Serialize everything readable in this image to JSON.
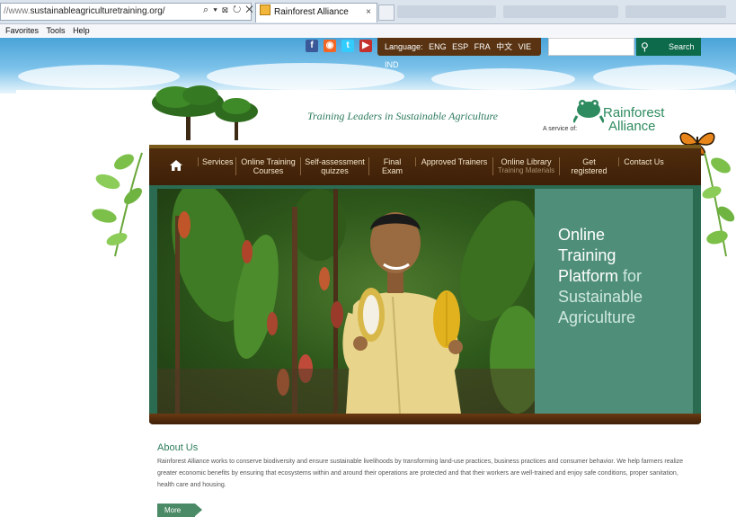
{
  "browser": {
    "url_prefix": "//www.",
    "url_main": "sustainableagriculturetraining.org/",
    "address_controls": "⌕ ▾ ⊠ ↻ ✕",
    "active_tab_title": "Rainforest Alliance",
    "active_tab_close": "×",
    "menu": [
      "Favorites",
      "Tools",
      "Help"
    ]
  },
  "header": {
    "social_icons": [
      "facebook-icon",
      "rss-icon",
      "twitter-icon",
      "youtube-icon"
    ],
    "social_glyphs": [
      "f",
      "◉",
      "t",
      "▶"
    ],
    "social_colors": [
      "#3b5998",
      "#f26522",
      "#33ccff",
      "#c4302b"
    ],
    "language_label": "Language:",
    "languages": [
      "ENG",
      "ESP",
      "FRA",
      "中文",
      "VIE",
      "IND"
    ],
    "search_button": "Search",
    "tagline": "Training Leaders in Sustainable Agriculture",
    "service_of": "A service of:",
    "brand_line1": "Rainforest",
    "brand_line2": "Alliance"
  },
  "nav": {
    "items": [
      {
        "label": "Services",
        "sub": ""
      },
      {
        "label": "Online Training Courses",
        "sub": ""
      },
      {
        "label": "Self-assessment quizzes",
        "sub": ""
      },
      {
        "label": "Final Exam",
        "sub": ""
      },
      {
        "label": "Approved Trainers",
        "sub": ""
      },
      {
        "label": "Online Library",
        "sub": "Training Materials"
      },
      {
        "label": "Get registered",
        "sub": ""
      },
      {
        "label": "Contact Us",
        "sub": ""
      }
    ]
  },
  "hero": {
    "line1": "Online",
    "line2": "Training",
    "line3a": "Platform",
    "line3b": " for",
    "line4": "Sustainable",
    "line5": "Agriculture"
  },
  "about": {
    "title": "About Us",
    "text": "Rainforest Alliance works to conserve biodiversity and ensure sustainable livelihoods by transforming land-use practices, business practices and consumer behavior. We help farmers realize greater economic benefits by ensuring that ecosystems within and around their operations are protected and that their workers are well-trained and enjoy safe conditions, proper sanitation, health care and housing.",
    "more_button": "More"
  },
  "colors": {
    "nav_bg": "#4f2c0c",
    "brand_green": "#2e8b5f",
    "hero_panel": "#4f8f79"
  }
}
